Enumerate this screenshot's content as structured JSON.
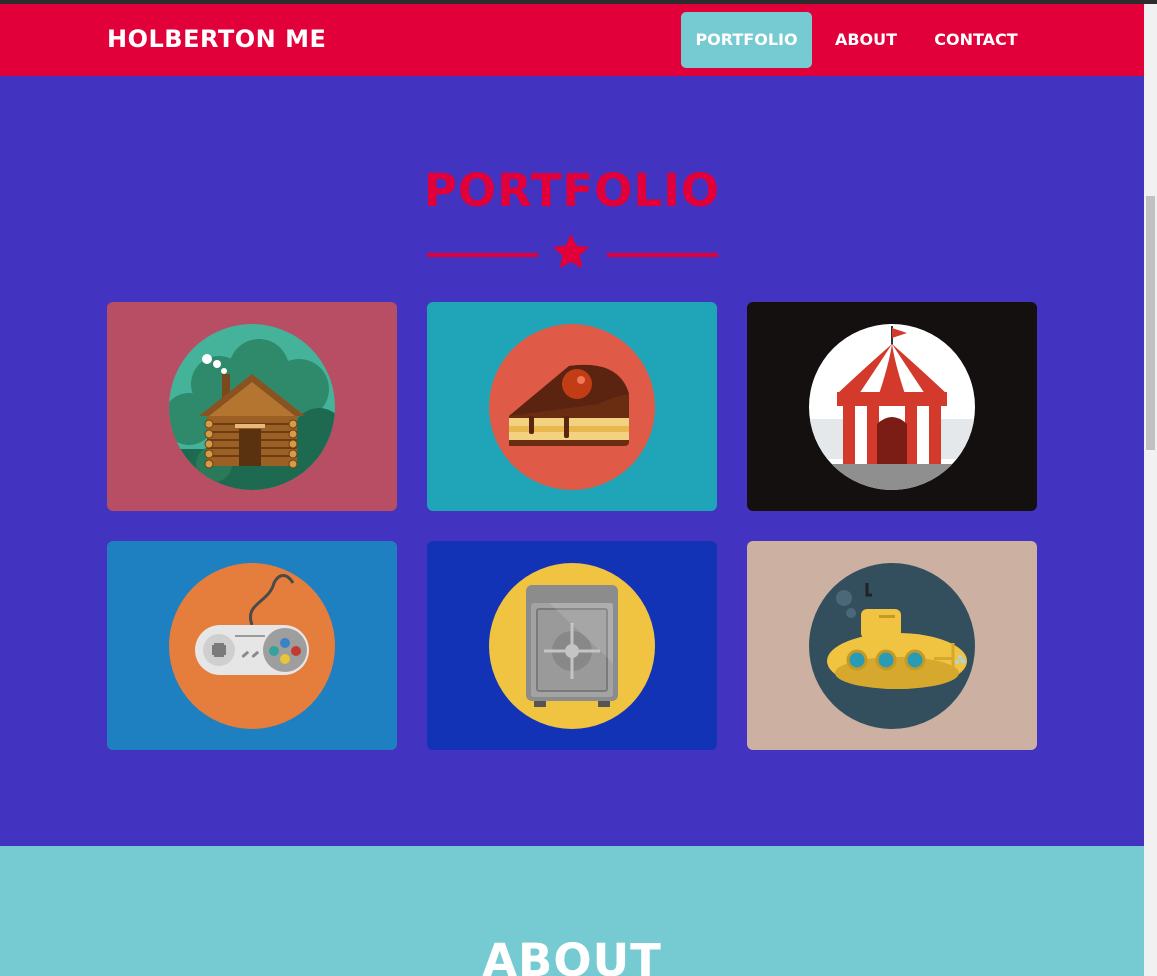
{
  "navbar": {
    "brand": "HOLBERTON ME",
    "items": [
      {
        "label": "PORTFOLIO",
        "active": true
      },
      {
        "label": "ABOUT",
        "active": false
      },
      {
        "label": "CONTACT",
        "active": false
      }
    ]
  },
  "portfolio": {
    "title": "PORTFOLIO",
    "divider_icon": "star-icon",
    "items": [
      {
        "icon": "cabin-icon",
        "background": "#b84e63",
        "circle": "#45b39a"
      },
      {
        "icon": "cake-icon",
        "background": "#20a4b8",
        "circle": "#df5b48"
      },
      {
        "icon": "circus-tent-icon",
        "background": "#141010",
        "circle": "#ffffff"
      },
      {
        "icon": "game-controller-icon",
        "background": "#1e7fc1",
        "circle": "#e57e3d"
      },
      {
        "icon": "safe-icon",
        "background": "#1233b6",
        "circle": "#f0c340"
      },
      {
        "icon": "submarine-icon",
        "background": "#ccb1a3",
        "circle": "#334f5e"
      }
    ]
  },
  "about": {
    "title": "ABOUT"
  },
  "colors": {
    "primary": "#e1003a",
    "accent": "#76cbd2",
    "page_background": "#4233c0"
  }
}
